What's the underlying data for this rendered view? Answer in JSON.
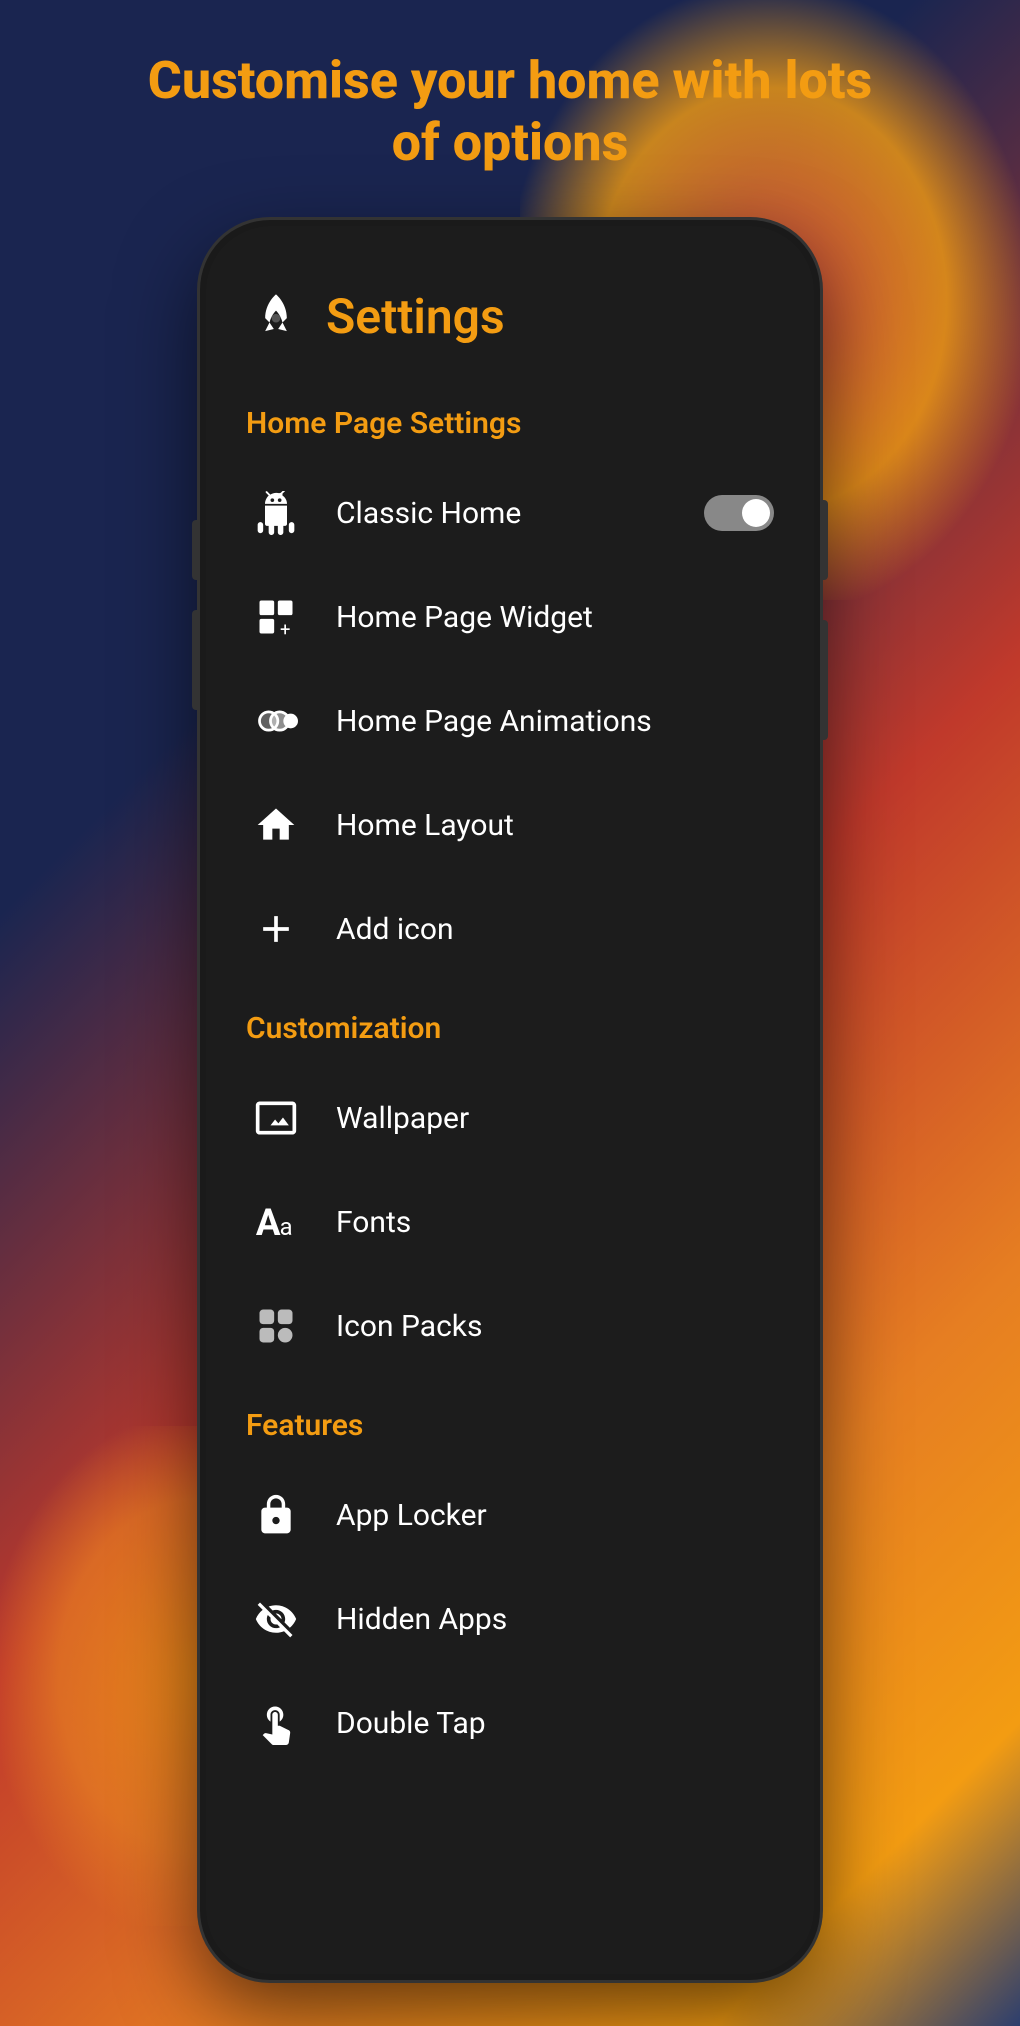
{
  "hero": {
    "title_line1": "Customise your home with lots",
    "title_line2": "of options"
  },
  "settings": {
    "title": "Settings",
    "sections": [
      {
        "id": "home-page-settings",
        "label": "Home Page Settings",
        "items": [
          {
            "id": "classic-home",
            "label": "Classic Home",
            "icon": "android",
            "hasToggle": true,
            "toggleOn": true
          },
          {
            "id": "home-page-widget",
            "label": "Home Page Widget",
            "icon": "widget",
            "hasToggle": false
          },
          {
            "id": "home-page-animations",
            "label": "Home Page Animations",
            "icon": "animations",
            "hasToggle": false
          },
          {
            "id": "home-layout",
            "label": "Home Layout",
            "icon": "home",
            "hasToggle": false
          },
          {
            "id": "add-icon",
            "label": "Add icon",
            "icon": "plus",
            "hasToggle": false
          }
        ]
      },
      {
        "id": "customization",
        "label": "Customization",
        "items": [
          {
            "id": "wallpaper",
            "label": "Wallpaper",
            "icon": "wallpaper",
            "hasToggle": false
          },
          {
            "id": "fonts",
            "label": "Fonts",
            "icon": "fonts",
            "hasToggle": false
          },
          {
            "id": "icon-packs",
            "label": "Icon Packs",
            "icon": "icon-packs",
            "hasToggle": false
          }
        ]
      },
      {
        "id": "features",
        "label": "Features",
        "items": [
          {
            "id": "app-locker",
            "label": "App Locker",
            "icon": "lock",
            "hasToggle": false
          },
          {
            "id": "hidden-apps",
            "label": "Hidden Apps",
            "icon": "hidden",
            "hasToggle": false
          },
          {
            "id": "double-tap",
            "label": "Double Tap",
            "icon": "double-tap",
            "hasToggle": false
          }
        ]
      }
    ]
  }
}
